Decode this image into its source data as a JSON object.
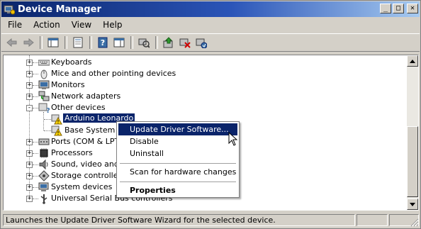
{
  "window": {
    "title": "Device Manager"
  },
  "title_buttons": {
    "minimize": "_",
    "maximize": "□",
    "close": "✕"
  },
  "menu": [
    "File",
    "Action",
    "View",
    "Help"
  ],
  "toolbar": {
    "icons": [
      "back-arrow-icon",
      "forward-arrow-icon",
      "show-hide-console-tree-icon",
      "properties-icon",
      "help-icon",
      "show-hide-action-pane-icon",
      "scan-hardware-icon",
      "update-driver-icon",
      "uninstall-icon",
      "enable-device-icon"
    ]
  },
  "tree": {
    "items": [
      {
        "label": "Keyboards",
        "icon": "keyboard-icon",
        "expander": "+"
      },
      {
        "label": "Mice and other pointing devices",
        "icon": "mouse-icon",
        "expander": "+"
      },
      {
        "label": "Monitors",
        "icon": "monitor-icon",
        "expander": "+"
      },
      {
        "label": "Network adapters",
        "icon": "network-adapter-icon",
        "expander": "+"
      },
      {
        "label": "Other devices",
        "icon": "unknown-device-icon",
        "expander": "-"
      },
      {
        "label": "Arduino Leonardo",
        "icon": "warning-device-icon",
        "child": true,
        "selected": true
      },
      {
        "label": "Base System De",
        "icon": "warning-device-icon",
        "child": true
      },
      {
        "label": "Ports (COM & LPT)",
        "icon": "port-icon",
        "expander": "+"
      },
      {
        "label": "Processors",
        "icon": "processor-icon",
        "expander": "+"
      },
      {
        "label": "Sound, video and ga",
        "icon": "sound-icon",
        "expander": "+"
      },
      {
        "label": "Storage controllers",
        "icon": "storage-icon",
        "expander": "+"
      },
      {
        "label": "System devices",
        "icon": "system-devices-icon",
        "expander": "+"
      },
      {
        "label": "Universal Serial Bus controllers",
        "icon": "usb-icon",
        "expander": "+"
      }
    ]
  },
  "context_menu": {
    "items": [
      {
        "label": "Update Driver Software...",
        "highlighted": true
      },
      {
        "label": "Disable"
      },
      {
        "label": "Uninstall"
      },
      {
        "separator": true
      },
      {
        "label": "Scan for hardware changes"
      },
      {
        "separator": true
      },
      {
        "label": "Properties",
        "bold": true
      }
    ]
  },
  "status": {
    "text": "Launches the Update Driver Software Wizard for the selected device."
  },
  "colors": {
    "title_gradient_start": "#0a246a",
    "title_gradient_end": "#a6caf0",
    "selection": "#0a246a",
    "face": "#d4d0c8",
    "warning": "#ffd700"
  }
}
